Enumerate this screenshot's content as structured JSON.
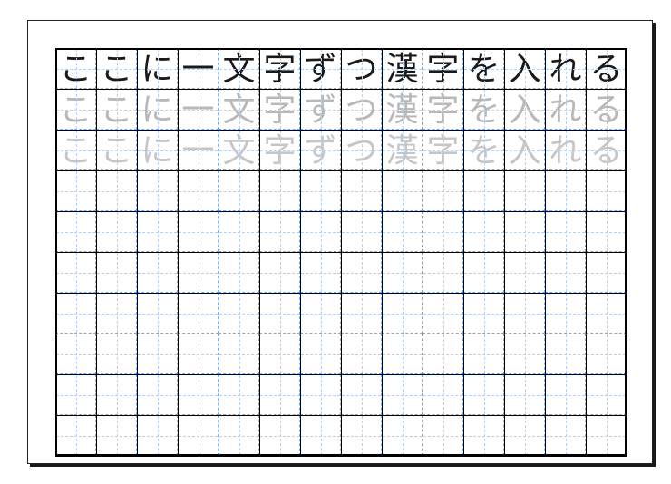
{
  "sheet": {
    "columns": 14,
    "rows": 10,
    "characters": [
      "こ",
      "こ",
      "に",
      "一",
      "文",
      "字",
      "ず",
      "つ",
      "漢",
      "字",
      "を",
      "入",
      "れ",
      "る"
    ],
    "traceRows": [
      0,
      1,
      2
    ]
  }
}
